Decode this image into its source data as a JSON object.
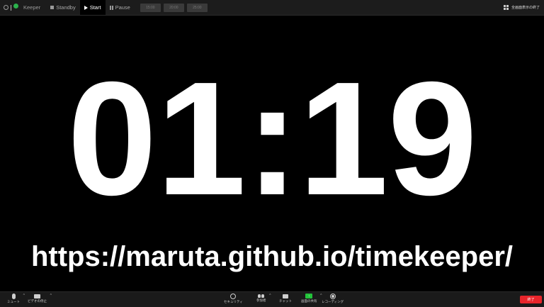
{
  "app": {
    "title": "Keeper"
  },
  "toolbar": {
    "standby_label": "Standby",
    "start_label": "Start",
    "pause_label": "Pause",
    "presets": [
      "15:00",
      "20:00",
      "25:00"
    ],
    "end_fullscreen_label": "全画面表示の終了"
  },
  "timer": {
    "display": "01:19"
  },
  "url": {
    "text": "https://maruta.github.io/timekeeper/"
  },
  "meeting_controls": {
    "mute_label": "ミュート",
    "video_label": "ビデオの停止",
    "security_label": "セキュリティ",
    "participants_label": "参加者",
    "participants_count": "1",
    "chat_label": "チャット",
    "share_label": "画面の共有",
    "record_label": "レコーディング",
    "end_label": "終了"
  },
  "colors": {
    "accent_green": "#2bb24c",
    "share_green": "#23c33a",
    "end_red": "#e8252b",
    "background": "#000000",
    "toolbar": "#1c1c1c"
  },
  "icons": [
    "settings-icon",
    "status-dot-icon",
    "stop-icon",
    "play-icon",
    "pause-icon",
    "grid-icon",
    "microphone-icon",
    "video-camera-icon",
    "shield-icon",
    "participants-icon",
    "chat-icon",
    "share-screen-icon",
    "record-icon"
  ]
}
